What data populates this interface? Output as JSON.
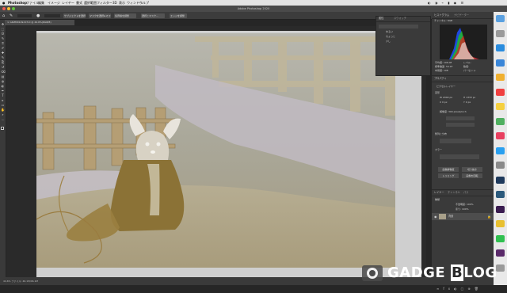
{
  "menubar": {
    "apple": "",
    "app_name": "Photoshop",
    "items": [
      "ファイル",
      "編集",
      "イメージ",
      "レイヤー",
      "書式",
      "選択範囲",
      "フィルター",
      "3D",
      "表示",
      "ウィンドウ",
      "ヘルプ"
    ]
  },
  "window": {
    "title": "Adobe Photoshop 2020"
  },
  "options_bar": {
    "buttons": [
      "サブジェクトを選択",
      "マスクを選択&マスク",
      "境界線を調整",
      "選択とマスク...",
      "エッジを調整"
    ]
  },
  "document": {
    "tab_label": "× GDZM0149.N-T-O @ 44.6%(RGB/8)",
    "zoom": "44.6%",
    "status": "44.6%   ファイル: 46.1M/46.1M"
  },
  "tools": {
    "icons": [
      "move-icon",
      "marquee-icon",
      "lasso-icon",
      "quick-select-icon",
      "crop-icon",
      "eyedropper-icon",
      "healing-icon",
      "brush-icon",
      "stamp-icon",
      "history-brush-icon",
      "eraser-icon",
      "gradient-icon",
      "blur-icon",
      "dodge-icon",
      "pen-icon",
      "type-icon",
      "path-select-icon",
      "rectangle-icon",
      "hand-icon",
      "zoom-icon",
      "more-icon"
    ],
    "glyphs": [
      "✥",
      "⬚",
      "ʘ",
      "✎",
      "⌗",
      "✐",
      "✚",
      "✎",
      "⎘",
      "↺",
      "⌫",
      "▤",
      "◍",
      "◐",
      "✒",
      "T",
      "▸",
      "▭",
      "✋",
      "⌕",
      "…"
    ]
  },
  "panel_small": {
    "tabs": [
      "属性",
      "スウォッチ"
    ],
    "rows": [
      "ゆるい",
      "ちょっと",
      "少し"
    ]
  },
  "histogram_panel": {
    "tabs": [
      "ヒストグラム",
      "ナビゲーター"
    ],
    "channel_label": "チャンネル: RGB",
    "stats": [
      "平均値: 106.08",
      "標準偏差: 54.97",
      "中間値: 108",
      "ピクセル数: 120000",
      "レベル:",
      "数値:",
      "パーセント:",
      "キャッシュ: 1"
    ],
    "colors": {
      "red": "#e02020",
      "green": "#20c020",
      "blue": "#2050ff",
      "cyan": "#40d0ff",
      "bg": "#1e1e1e"
    }
  },
  "properties_panel": {
    "title": "プロパティ",
    "subtitle": "ピクセルレイヤー",
    "transform_label": "変形",
    "fields": [
      "W 2000 px",
      "H 1333 px",
      "X 0 px",
      "Y 0 px"
    ],
    "doc_size_label": "解像度: 300 pixels/inch",
    "align_label": "整列と分布",
    "mode_label": "カラー",
    "buttons": [
      "画像解像度",
      "切り抜き",
      "トリミング",
      "画像を回転"
    ]
  },
  "layers_panel": {
    "tabs": [
      "レイヤー",
      "チャンネル",
      "パス"
    ],
    "kind_label": "種類",
    "opacity_label": "不透明度: 100%",
    "fill_label": "塗り: 100%",
    "layer_name": "背景"
  },
  "dock": {
    "icons": [
      "finder-icon",
      "launchpad-icon",
      "safari-icon",
      "mail-icon",
      "photos-icon",
      "calendar-icon",
      "notes-icon",
      "maps-icon",
      "music-icon",
      "appstore-icon",
      "prefs-icon",
      "photoshop-icon",
      "lightroom-icon",
      "premiere-icon",
      "chrome-icon",
      "line-icon",
      "slack-icon",
      "trash-icon"
    ],
    "colors": [
      "#5aa0e0",
      "#9a9a9a",
      "#2a8cde",
      "#3a86d8",
      "#f0b030",
      "#f04040",
      "#f5d040",
      "#50b060",
      "#e84060",
      "#2aa0f0",
      "#8a8a8a",
      "#1f3a5c",
      "#2c5a7c",
      "#3a1c50",
      "#e8c030",
      "#30c050",
      "#5a2a6a",
      "#9a9a9a"
    ]
  },
  "watermark": {
    "text_left": "GADGE",
    "text_b": "B",
    "text_right": "LOG"
  }
}
